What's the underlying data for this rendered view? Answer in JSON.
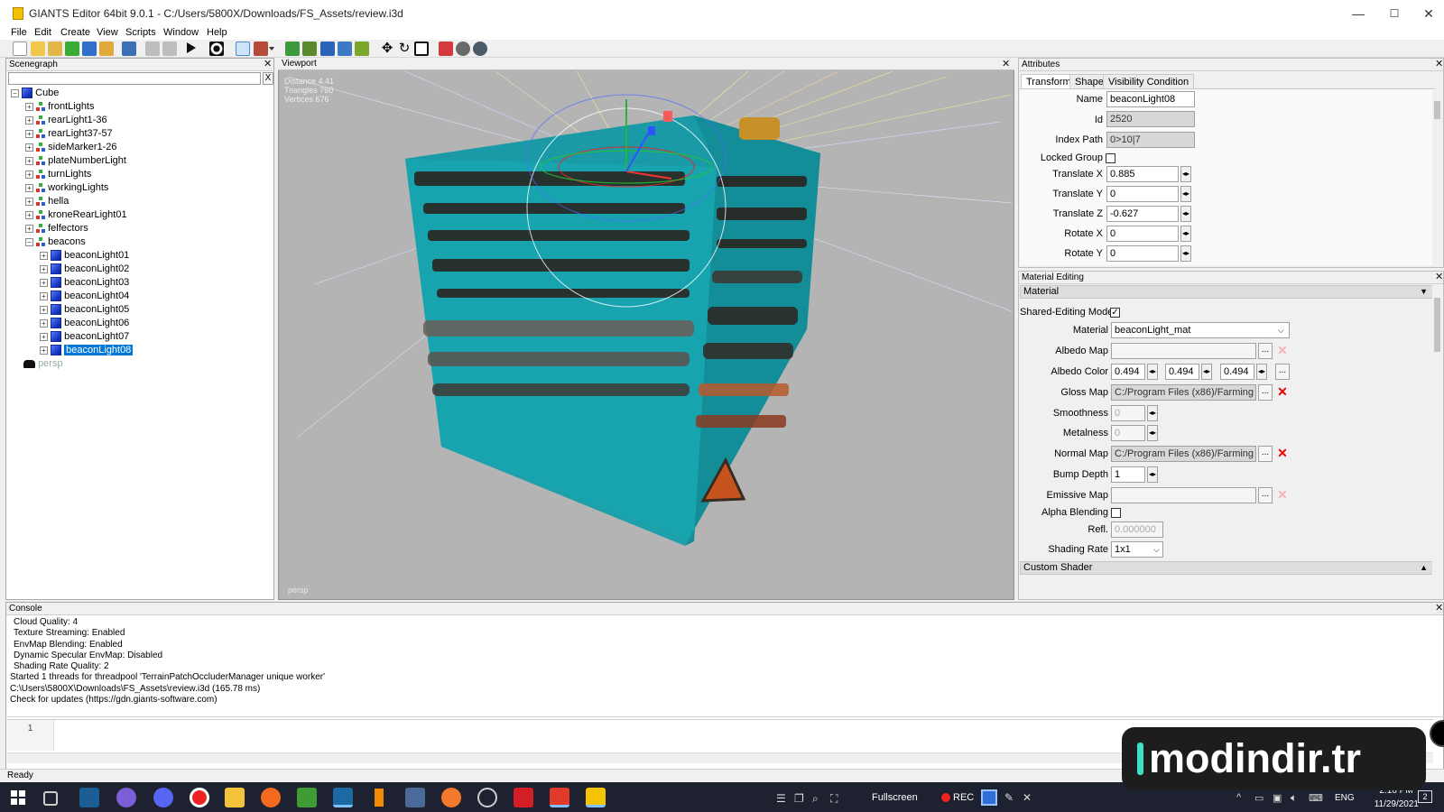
{
  "window": {
    "title": "GIANTS Editor 64bit 9.0.1 - C:/Users/5800X/Downloads/FS_Assets/review.i3d",
    "minimize": "—",
    "maximize": "☐",
    "close": "✕"
  },
  "menu": [
    "File",
    "Edit",
    "Create",
    "View",
    "Scripts",
    "Window",
    "Help"
  ],
  "scenegraph": {
    "title": "Scenegraph",
    "filter_clear": "X",
    "root": "Cube",
    "groups": [
      "frontLights",
      "rearLight1-36",
      "rearLight37-57",
      "sideMarker1-26",
      "plateNumberLight",
      "turnLights",
      "workingLights",
      "hella",
      "kroneRearLight01",
      "felfectors",
      "beacons"
    ],
    "beacons": [
      "beaconLight01",
      "beaconLight02",
      "beaconLight03",
      "beaconLight04",
      "beaconLight05",
      "beaconLight06",
      "beaconLight07",
      "beaconLight08"
    ],
    "camera": "persp"
  },
  "viewport": {
    "title": "Viewport",
    "distance": "Distance 4.41",
    "triangles": "Triangles 760",
    "vertices": "Vertices 676",
    "camera": "persp"
  },
  "attributes": {
    "title": "Attributes",
    "tabs": [
      "Transform",
      "Shape",
      "Visibility Condition"
    ],
    "name_label": "Name",
    "name": "beaconLight08",
    "id_label": "Id",
    "id": "2520",
    "index_path_label": "Index Path",
    "index_path": "0>10|7",
    "locked_group_label": "Locked Group",
    "translate_x_label": "Translate X",
    "translate_x": "0.885",
    "translate_y_label": "Translate Y",
    "translate_y": "0",
    "translate_z_label": "Translate Z",
    "translate_z": "-0.627",
    "rotate_x_label": "Rotate X",
    "rotate_x": "0",
    "rotate_y_label": "Rotate Y",
    "rotate_y": "0"
  },
  "material": {
    "title": "Material Editing",
    "section": "Material",
    "shared_label": "Shared-Editing Mode",
    "material_label": "Material",
    "material": "beaconLight_mat",
    "albedo_map_label": "Albedo Map",
    "albedo_color_label": "Albedo Color",
    "albedo_r": "0.494",
    "albedo_g": "0.494",
    "albedo_b": "0.494",
    "gloss_map_label": "Gloss Map",
    "gloss_map": "C:/Program Files (x86)/Farming Sim",
    "smoothness_label": "Smoothness",
    "smoothness": "0",
    "metalness_label": "Metalness",
    "metalness": "0",
    "normal_map_label": "Normal Map",
    "normal_map": "C:/Program Files (x86)/Farming Sim",
    "bump_label": "Bump Depth",
    "bump": "1",
    "emissive_label": "Emissive Map",
    "alpha_label": "Alpha Blending",
    "refl_label": "Refl.",
    "refl": "0.000000",
    "shading_label": "Shading Rate",
    "shading": "1x1",
    "custom_shader": "Custom Shader",
    "dots": "...",
    "x": "✕"
  },
  "console": {
    "title": "Console",
    "lines": [
      "Cloud Quality: 4",
      "Texture Streaming: Enabled",
      "EnvMap Blending: Enabled",
      "Dynamic Specular EnvMap: Disabled",
      "Shading Rate Quality: 2",
      "Started 1 threads for threadpool 'TerrainPatchOccluderManager unique worker'",
      "C:\\Users\\5800X\\Downloads\\FS_Assets\\review.i3d (165.78 ms)",
      "Check for updates (https://gdn.giants-software.com)"
    ],
    "input_line": "1"
  },
  "status": "Ready",
  "taskbar": {
    "fullscreen": "Fullscreen",
    "rec": "REC",
    "lang": "ENG",
    "time": "2:16 PM",
    "date": "11/29/2021",
    "notif": "2"
  },
  "watermark": "modindir.tr",
  "colors": {
    "cube": "#1a9ba6",
    "selection": "#0078d7",
    "watermark_accent": "#3fe0c6"
  }
}
